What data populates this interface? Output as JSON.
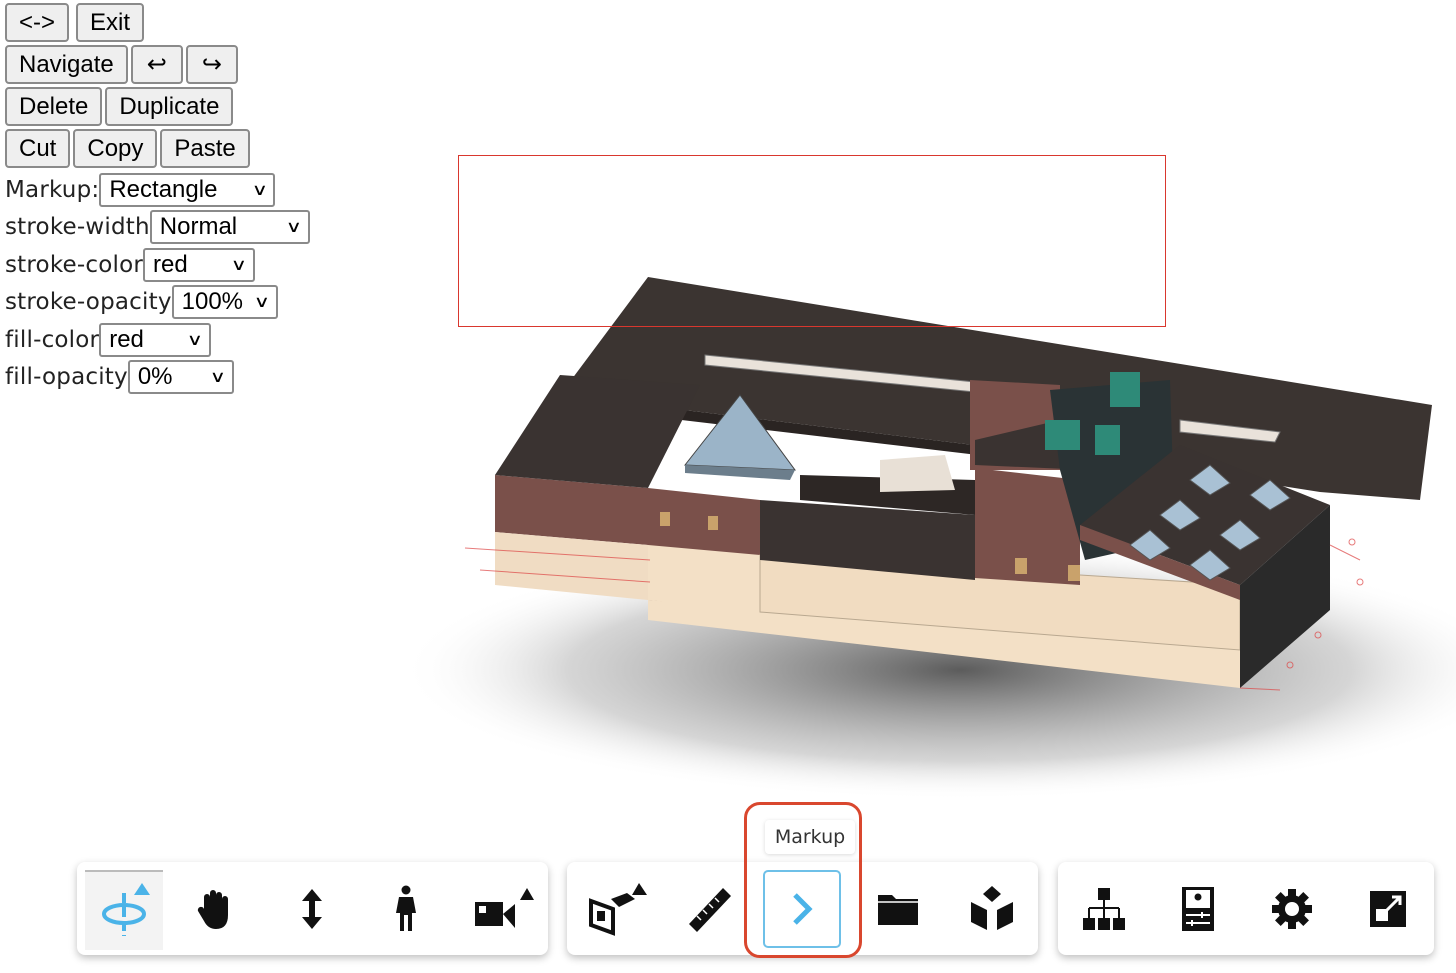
{
  "panel": {
    "row1": [
      "<->",
      "Exit"
    ],
    "row2": [
      "Navigate",
      "↩",
      "↪"
    ],
    "row3": [
      "Delete",
      "Duplicate"
    ],
    "row4": [
      "Cut",
      "Copy",
      "Paste"
    ],
    "fields": [
      {
        "label": "Markup:",
        "value": "Rectangle"
      },
      {
        "label": "stroke-width",
        "value": "Normal"
      },
      {
        "label": "stroke-color",
        "value": "red"
      },
      {
        "label": "stroke-opacity",
        "value": "100%"
      },
      {
        "label": "fill-color",
        "value": "red"
      },
      {
        "label": "fill-opacity",
        "value": "0%"
      }
    ]
  },
  "markup": {
    "shape": "rectangle",
    "stroke_color": "#d9372e"
  },
  "toolbar": {
    "tooltip": "Markup",
    "accent": "#4ab3e8",
    "groups": [
      [
        "orbit-icon",
        "pan-icon",
        "zoom-icon",
        "first-person-icon",
        "camera-icon"
      ],
      [
        "section-icon",
        "measure-icon",
        "markup-icon",
        "folder-icon",
        "explode-icon"
      ],
      [
        "model-browser-icon",
        "properties-icon",
        "settings-icon",
        "fullscreen-icon"
      ]
    ]
  }
}
